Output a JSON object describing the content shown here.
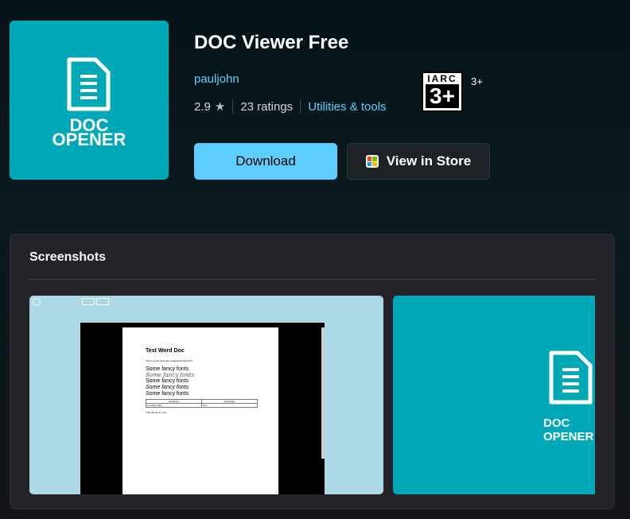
{
  "app": {
    "name": "DOC Viewer Free",
    "publisher": "pauljohn",
    "rating": "2.9",
    "ratings_count": "23 ratings",
    "category": "Utilities & tools",
    "icon": {
      "name": "document-icon",
      "line1": "DOC",
      "line2": "OPENER",
      "background": "#00a8b8"
    },
    "age_rating": {
      "badge_top": "IARC",
      "badge_number": "3+",
      "label": "3+"
    }
  },
  "actions": {
    "download_label": "Download",
    "store_label": "View in Store",
    "store_icon": "store-bag-icon"
  },
  "screenshots": {
    "title": "Screenshots",
    "shot1": {
      "doc_title": "Test Word Doc",
      "doc_intro": "This is a test word doc created with Word 97.",
      "fonts": [
        "Some fancy fonts",
        "Some fancy fonts",
        "Some fancy fonts",
        "Some fancy fonts",
        "Some fancy fonts"
      ],
      "table": {
        "headers": [
          "Heading1",
          "Heading2"
        ],
        "row": [
          "A simple table",
          "Text"
        ]
      },
      "doc_end": "That will do for now."
    },
    "shot2": {
      "line1": "DOC",
      "line2": "OPENER"
    }
  },
  "colors": {
    "accent": "#60cdff",
    "button_dark": "#1c2226",
    "panel": "#232329",
    "teal": "#00a8b8"
  }
}
